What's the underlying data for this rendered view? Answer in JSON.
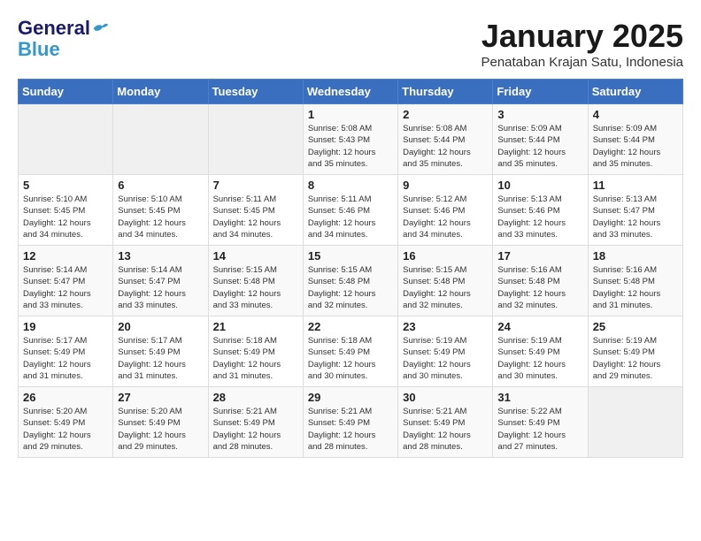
{
  "header": {
    "logo_line1": "General",
    "logo_line2": "Blue",
    "month_title": "January 2025",
    "location": "Penataban Krajan Satu, Indonesia"
  },
  "weekdays": [
    "Sunday",
    "Monday",
    "Tuesday",
    "Wednesday",
    "Thursday",
    "Friday",
    "Saturday"
  ],
  "weeks": [
    [
      {
        "day": "",
        "info": ""
      },
      {
        "day": "",
        "info": ""
      },
      {
        "day": "",
        "info": ""
      },
      {
        "day": "1",
        "info": "Sunrise: 5:08 AM\nSunset: 5:43 PM\nDaylight: 12 hours\nand 35 minutes."
      },
      {
        "day": "2",
        "info": "Sunrise: 5:08 AM\nSunset: 5:44 PM\nDaylight: 12 hours\nand 35 minutes."
      },
      {
        "day": "3",
        "info": "Sunrise: 5:09 AM\nSunset: 5:44 PM\nDaylight: 12 hours\nand 35 minutes."
      },
      {
        "day": "4",
        "info": "Sunrise: 5:09 AM\nSunset: 5:44 PM\nDaylight: 12 hours\nand 35 minutes."
      }
    ],
    [
      {
        "day": "5",
        "info": "Sunrise: 5:10 AM\nSunset: 5:45 PM\nDaylight: 12 hours\nand 34 minutes."
      },
      {
        "day": "6",
        "info": "Sunrise: 5:10 AM\nSunset: 5:45 PM\nDaylight: 12 hours\nand 34 minutes."
      },
      {
        "day": "7",
        "info": "Sunrise: 5:11 AM\nSunset: 5:45 PM\nDaylight: 12 hours\nand 34 minutes."
      },
      {
        "day": "8",
        "info": "Sunrise: 5:11 AM\nSunset: 5:46 PM\nDaylight: 12 hours\nand 34 minutes."
      },
      {
        "day": "9",
        "info": "Sunrise: 5:12 AM\nSunset: 5:46 PM\nDaylight: 12 hours\nand 34 minutes."
      },
      {
        "day": "10",
        "info": "Sunrise: 5:13 AM\nSunset: 5:46 PM\nDaylight: 12 hours\nand 33 minutes."
      },
      {
        "day": "11",
        "info": "Sunrise: 5:13 AM\nSunset: 5:47 PM\nDaylight: 12 hours\nand 33 minutes."
      }
    ],
    [
      {
        "day": "12",
        "info": "Sunrise: 5:14 AM\nSunset: 5:47 PM\nDaylight: 12 hours\nand 33 minutes."
      },
      {
        "day": "13",
        "info": "Sunrise: 5:14 AM\nSunset: 5:47 PM\nDaylight: 12 hours\nand 33 minutes."
      },
      {
        "day": "14",
        "info": "Sunrise: 5:15 AM\nSunset: 5:48 PM\nDaylight: 12 hours\nand 33 minutes."
      },
      {
        "day": "15",
        "info": "Sunrise: 5:15 AM\nSunset: 5:48 PM\nDaylight: 12 hours\nand 32 minutes."
      },
      {
        "day": "16",
        "info": "Sunrise: 5:15 AM\nSunset: 5:48 PM\nDaylight: 12 hours\nand 32 minutes."
      },
      {
        "day": "17",
        "info": "Sunrise: 5:16 AM\nSunset: 5:48 PM\nDaylight: 12 hours\nand 32 minutes."
      },
      {
        "day": "18",
        "info": "Sunrise: 5:16 AM\nSunset: 5:48 PM\nDaylight: 12 hours\nand 31 minutes."
      }
    ],
    [
      {
        "day": "19",
        "info": "Sunrise: 5:17 AM\nSunset: 5:49 PM\nDaylight: 12 hours\nand 31 minutes."
      },
      {
        "day": "20",
        "info": "Sunrise: 5:17 AM\nSunset: 5:49 PM\nDaylight: 12 hours\nand 31 minutes."
      },
      {
        "day": "21",
        "info": "Sunrise: 5:18 AM\nSunset: 5:49 PM\nDaylight: 12 hours\nand 31 minutes."
      },
      {
        "day": "22",
        "info": "Sunrise: 5:18 AM\nSunset: 5:49 PM\nDaylight: 12 hours\nand 30 minutes."
      },
      {
        "day": "23",
        "info": "Sunrise: 5:19 AM\nSunset: 5:49 PM\nDaylight: 12 hours\nand 30 minutes."
      },
      {
        "day": "24",
        "info": "Sunrise: 5:19 AM\nSunset: 5:49 PM\nDaylight: 12 hours\nand 30 minutes."
      },
      {
        "day": "25",
        "info": "Sunrise: 5:19 AM\nSunset: 5:49 PM\nDaylight: 12 hours\nand 29 minutes."
      }
    ],
    [
      {
        "day": "26",
        "info": "Sunrise: 5:20 AM\nSunset: 5:49 PM\nDaylight: 12 hours\nand 29 minutes."
      },
      {
        "day": "27",
        "info": "Sunrise: 5:20 AM\nSunset: 5:49 PM\nDaylight: 12 hours\nand 29 minutes."
      },
      {
        "day": "28",
        "info": "Sunrise: 5:21 AM\nSunset: 5:49 PM\nDaylight: 12 hours\nand 28 minutes."
      },
      {
        "day": "29",
        "info": "Sunrise: 5:21 AM\nSunset: 5:49 PM\nDaylight: 12 hours\nand 28 minutes."
      },
      {
        "day": "30",
        "info": "Sunrise: 5:21 AM\nSunset: 5:49 PM\nDaylight: 12 hours\nand 28 minutes."
      },
      {
        "day": "31",
        "info": "Sunrise: 5:22 AM\nSunset: 5:49 PM\nDaylight: 12 hours\nand 27 minutes."
      },
      {
        "day": "",
        "info": ""
      }
    ]
  ]
}
